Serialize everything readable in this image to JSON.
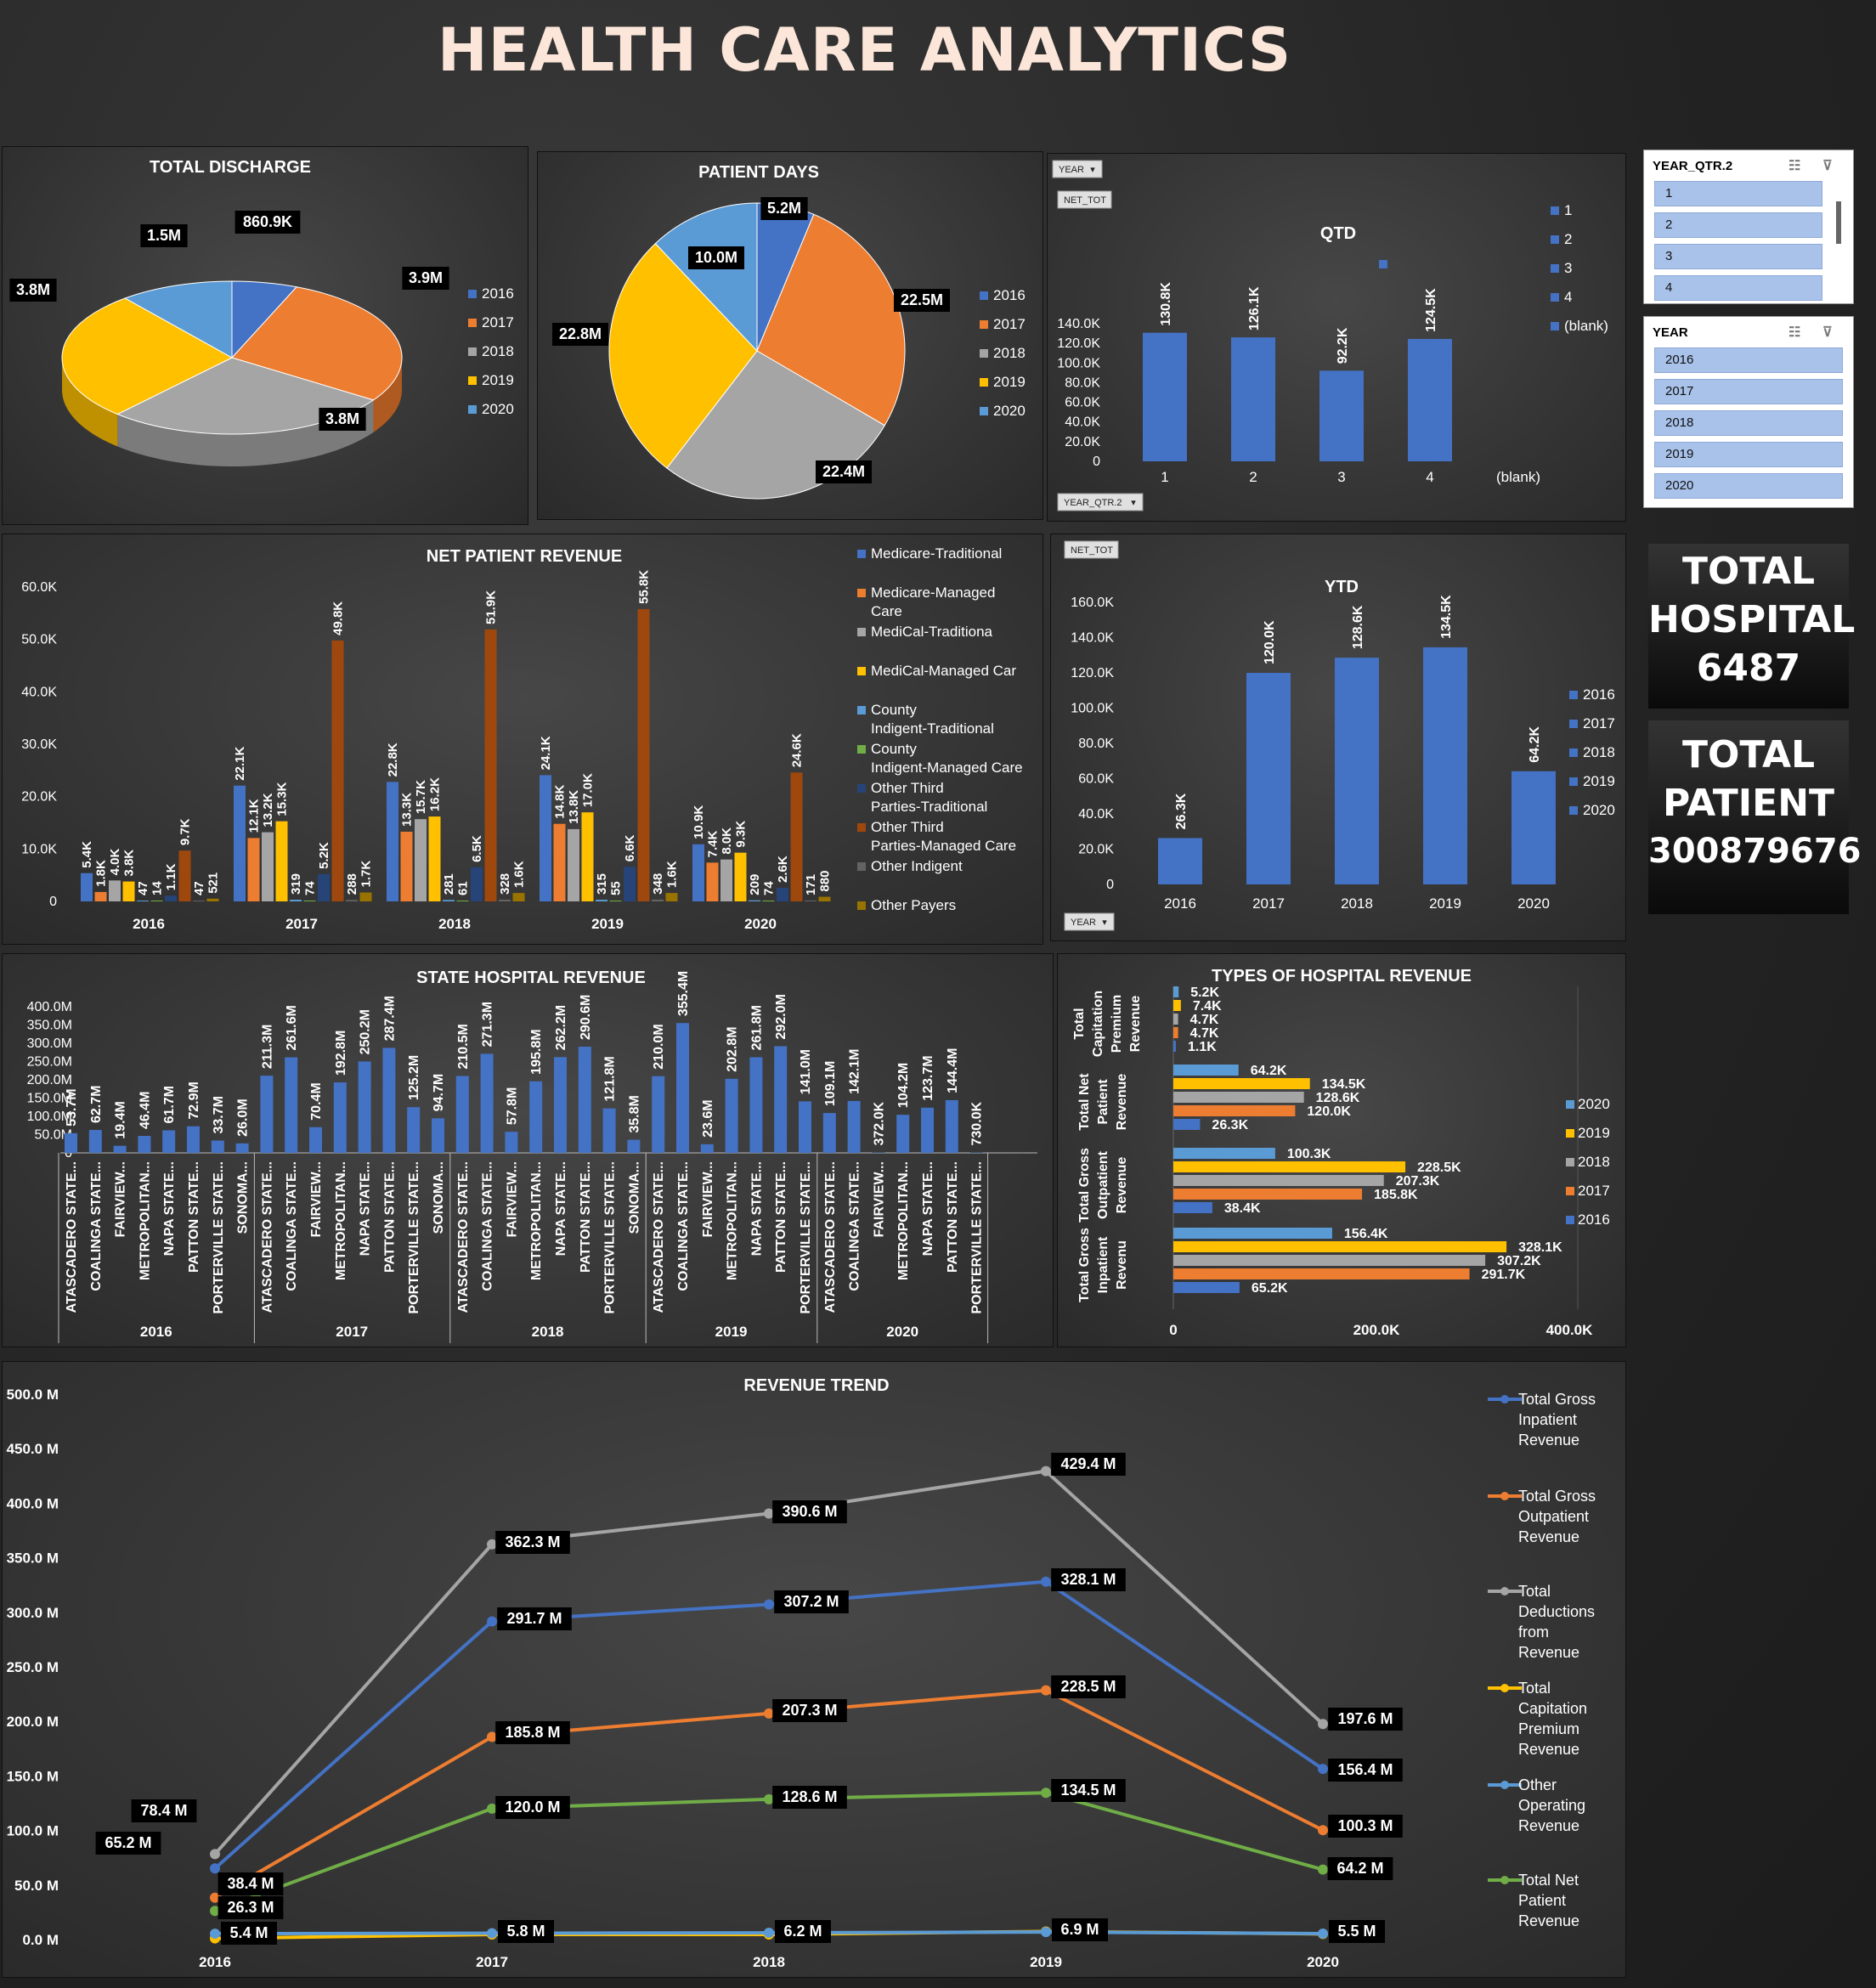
{
  "title": "HEALTH CARE ANALYTICS",
  "years": [
    "2016",
    "2017",
    "2018",
    "2019",
    "2020"
  ],
  "colors": {
    "y2016": "#4472c4",
    "y2017": "#ed7d31",
    "y2018": "#a5a5a5",
    "y2019": "#ffc000",
    "y2020": "#5b9bd5"
  },
  "slicers": {
    "qtr": {
      "title": "YEAR_QTR.2",
      "items": [
        "1",
        "2",
        "3",
        "4"
      ]
    },
    "year": {
      "title": "YEAR",
      "items": [
        "2016",
        "2017",
        "2018",
        "2019",
        "2020"
      ]
    }
  },
  "kpis": {
    "hospital": {
      "l1": "TOTAL",
      "l2": "HOSPITAL",
      "value": "6487"
    },
    "patient": {
      "l1": "TOTAL",
      "l2": "PATIENT",
      "value": "300879676"
    }
  },
  "chart_data": [
    {
      "id": "discharge",
      "type": "pie",
      "title": "TOTAL DISCHARGE",
      "categories": [
        "2016",
        "2017",
        "2018",
        "2019",
        "2020"
      ],
      "values": [
        860.9,
        3900,
        3800,
        3800,
        1500
      ],
      "labels": [
        "860.9K",
        "3.9M",
        "3.8M",
        "3.8M",
        "1.5M"
      ],
      "legend": "right"
    },
    {
      "id": "patient_days",
      "type": "pie",
      "title": "PATIENT DAYS",
      "categories": [
        "2016",
        "2017",
        "2018",
        "2019",
        "2020"
      ],
      "values": [
        5.2,
        22.5,
        22.4,
        22.8,
        10.0
      ],
      "labels": [
        "5.2M",
        "22.5M",
        "22.4M",
        "22.8M",
        "10.0M"
      ],
      "legend": "right"
    },
    {
      "id": "qtd",
      "type": "bar",
      "title": "QTD",
      "field_buttons": [
        "YEAR",
        "NET_TOT",
        "YEAR_QTR.2"
      ],
      "categories": [
        "1",
        "2",
        "3",
        "4",
        "(blank)"
      ],
      "values": [
        130.8,
        126.1,
        92.2,
        124.5,
        null
      ],
      "labels": [
        "130.8K",
        "126.1K",
        "92.2K",
        "124.5K",
        ""
      ],
      "ylim": [
        0,
        140
      ],
      "yticks": [
        "0",
        "20.0K",
        "40.0K",
        "60.0K",
        "80.0K",
        "100.0K",
        "120.0K",
        "140.0K"
      ],
      "legend": [
        "1",
        "2",
        "3",
        "4",
        "(blank)"
      ]
    },
    {
      "id": "net_patient_revenue",
      "type": "bar",
      "title": "NET PATIENT REVENUE",
      "categories": [
        "2016",
        "2017",
        "2018",
        "2019",
        "2020"
      ],
      "series": [
        {
          "name": "Medicare-Traditional",
          "color": "#4472c4",
          "values": [
            5.4,
            22.1,
            22.8,
            24.1,
            10.9
          ],
          "labels": [
            "5.4K",
            "22.1K",
            "22.8K",
            "24.1K",
            "10.9K"
          ]
        },
        {
          "name": "Medicare-Managed Care",
          "color": "#ed7d31",
          "values": [
            1.8,
            12.1,
            13.3,
            14.8,
            7.4
          ],
          "labels": [
            "1.8K",
            "12.1K",
            "13.3K",
            "14.8K",
            "7.4K"
          ]
        },
        {
          "name": "MediCal-Traditiona",
          "color": "#a5a5a5",
          "values": [
            4.0,
            13.2,
            15.7,
            13.8,
            8.0
          ],
          "labels": [
            "4.0K",
            "13.2K",
            "15.7K",
            "13.8K",
            "8.0K"
          ]
        },
        {
          "name": "MediCal-Managed Car",
          "color": "#ffc000",
          "values": [
            3.8,
            15.3,
            16.2,
            17.0,
            9.3
          ],
          "labels": [
            "3.8K",
            "15.3K",
            "16.2K",
            "17.0K",
            "9.3K"
          ]
        },
        {
          "name": "County Indigent-Traditional",
          "color": "#5b9bd5",
          "values": [
            0.047,
            0.319,
            0.281,
            0.315,
            0.209
          ],
          "labels": [
            "47",
            "319",
            "281",
            "315",
            "209"
          ]
        },
        {
          "name": "County Indigent-Managed Care",
          "color": "#70ad47",
          "values": [
            0.014,
            0.074,
            0.061,
            0.055,
            0.074
          ],
          "labels": [
            "14",
            "74",
            "61",
            "55",
            "74"
          ]
        },
        {
          "name": "Other Third Parties-Traditional",
          "color": "#264478",
          "values": [
            1.1,
            5.2,
            6.5,
            6.6,
            2.6
          ],
          "labels": [
            "1.1K",
            "5.2K",
            "6.5K",
            "6.6K",
            "2.6K"
          ]
        },
        {
          "name": "Other Third Parties-Managed Care",
          "color": "#9e480e",
          "values": [
            9.7,
            49.8,
            51.9,
            55.8,
            24.6
          ],
          "labels": [
            "9.7K",
            "49.8K",
            "51.9K",
            "55.8K",
            "24.6K"
          ]
        },
        {
          "name": "Other Indigent",
          "color": "#636363",
          "values": [
            0.047,
            0.288,
            0.328,
            0.348,
            0.171
          ],
          "labels": [
            "47",
            "288",
            "328",
            "348",
            "171"
          ]
        },
        {
          "name": "Other Payers",
          "color": "#997300",
          "values": [
            0.521,
            1.7,
            1.6,
            1.6,
            0.88
          ],
          "labels": [
            "521",
            "1.7K",
            "1.6K",
            "1.6K",
            "880"
          ]
        }
      ],
      "ylim": [
        0,
        60
      ],
      "yticks": [
        "0",
        "10.0K",
        "20.0K",
        "30.0K",
        "40.0K",
        "50.0K",
        "60.0K"
      ]
    },
    {
      "id": "ytd",
      "type": "bar",
      "title": "YTD",
      "field_buttons": [
        "NET_TOT",
        "YEAR"
      ],
      "categories": [
        "2016",
        "2017",
        "2018",
        "2019",
        "2020"
      ],
      "values": [
        26.3,
        120.0,
        128.6,
        134.5,
        64.2
      ],
      "labels": [
        "26.3K",
        "120.0K",
        "128.6K",
        "134.5K",
        "64.2K"
      ],
      "ylim": [
        0,
        160
      ],
      "yticks": [
        "0",
        "20.0K",
        "40.0K",
        "60.0K",
        "80.0K",
        "100.0K",
        "120.0K",
        "140.0K",
        "160.0K"
      ],
      "legend": [
        "2016",
        "2017",
        "2018",
        "2019",
        "2020"
      ]
    },
    {
      "id": "state_hospital_revenue",
      "type": "bar",
      "title": "STATE HOSPITAL REVENUE",
      "groups": [
        {
          "year": "2016",
          "bars": [
            [
              "ATASCADERO STATE...",
              53.7,
              "53.7M"
            ],
            [
              "COALINGA STATE...",
              62.7,
              "62.7M"
            ],
            [
              "FAIRVIEW...",
              19.4,
              "19.4M"
            ],
            [
              "METROPOLITAN...",
              46.4,
              "46.4M"
            ],
            [
              "NAPA STATE...",
              61.7,
              "61.7M"
            ],
            [
              "PATTON STATE...",
              72.9,
              "72.9M"
            ],
            [
              "PORTERVILLE STATE...",
              33.7,
              "33.7M"
            ],
            [
              "SONOMA...",
              26.0,
              "26.0M"
            ]
          ]
        },
        {
          "year": "2017",
          "bars": [
            [
              "ATASCADERO STATE...",
              211.3,
              "211.3M"
            ],
            [
              "COALINGA STATE...",
              261.6,
              "261.6M"
            ],
            [
              "FAIRVIEW...",
              70.4,
              "70.4M"
            ],
            [
              "METROPOLITAN...",
              192.8,
              "192.8M"
            ],
            [
              "NAPA STATE...",
              250.2,
              "250.2M"
            ],
            [
              "PATTON STATE...",
              287.4,
              "287.4M"
            ],
            [
              "PORTERVILLE STATE...",
              125.2,
              "125.2M"
            ],
            [
              "SONOMA...",
              94.7,
              "94.7M"
            ]
          ]
        },
        {
          "year": "2018",
          "bars": [
            [
              "ATASCADERO STATE...",
              210.5,
              "210.5M"
            ],
            [
              "COALINGA STATE...",
              271.3,
              "271.3M"
            ],
            [
              "FAIRVIEW...",
              57.8,
              "57.8M"
            ],
            [
              "METROPOLITAN...",
              195.8,
              "195.8M"
            ],
            [
              "NAPA STATE...",
              262.2,
              "262.2M"
            ],
            [
              "PATTON STATE...",
              290.6,
              "290.6M"
            ],
            [
              "PORTERVILLE STATE...",
              121.8,
              "121.8M"
            ],
            [
              "SONOMA...",
              35.8,
              "35.8M"
            ]
          ]
        },
        {
          "year": "2019",
          "bars": [
            [
              "ATASCADERO STATE...",
              210.0,
              "210.0M"
            ],
            [
              "COALINGA STATE...",
              355.4,
              "355.4M"
            ],
            [
              "FAIRVIEW...",
              23.6,
              "23.6M"
            ],
            [
              "METROPOLITAN...",
              202.8,
              "202.8M"
            ],
            [
              "NAPA STATE...",
              261.8,
              "261.8M"
            ],
            [
              "PATTON STATE...",
              292.0,
              "292.0M"
            ],
            [
              "PORTERVILLE STATE...",
              141.0,
              "141.0M"
            ]
          ]
        },
        {
          "year": "2020",
          "bars": [
            [
              "ATASCADERO STATE...",
              109.1,
              "109.1M"
            ],
            [
              "COALINGA STATE...",
              142.1,
              "142.1M"
            ],
            [
              "FAIRVIEW...",
              0.372,
              "372.0K"
            ],
            [
              "METROPOLITAN...",
              104.2,
              "104.2M"
            ],
            [
              "NAPA STATE...",
              123.7,
              "123.7M"
            ],
            [
              "PATTON STATE...",
              144.4,
              "144.4M"
            ],
            [
              "PORTERVILLE STATE...",
              0.73,
              "730.0K"
            ]
          ]
        }
      ],
      "ylim": [
        0,
        400
      ],
      "yticks": [
        "0",
        "50.0M",
        "100.0M",
        "150.0M",
        "200.0M",
        "250.0M",
        "300.0M",
        "350.0M",
        "400.0M"
      ]
    },
    {
      "id": "types_of_hospital_revenue",
      "type": "bar",
      "orientation": "horizontal",
      "title": "TYPES OF HOSPITAL REVENUE",
      "categories": [
        "Total Capitation Premium Revenue",
        "Total Net Patient Revenue",
        "Total Gross Outpatient Revenue",
        "Total Gross Inpatient Revenu"
      ],
      "series": [
        {
          "name": "2020",
          "values": [
            5.2,
            64.2,
            100.3,
            156.4
          ],
          "labels": [
            "5.2K",
            "64.2K",
            "100.3K",
            "156.4K"
          ]
        },
        {
          "name": "2019",
          "values": [
            7.4,
            134.5,
            228.5,
            328.1
          ],
          "labels": [
            "7.4K",
            "134.5K",
            "228.5K",
            "328.1K"
          ]
        },
        {
          "name": "2018",
          "values": [
            4.7,
            128.6,
            207.3,
            307.2
          ],
          "labels": [
            "4.7K",
            "128.6K",
            "207.3K",
            "307.2K"
          ]
        },
        {
          "name": "2017",
          "values": [
            4.7,
            120.0,
            185.8,
            291.7
          ],
          "labels": [
            "4.7K",
            "120.0K",
            "185.8K",
            "291.7K"
          ]
        },
        {
          "name": "2016",
          "values": [
            1.1,
            26.3,
            38.4,
            65.2
          ],
          "labels": [
            "1.1K",
            "26.3K",
            "38.4K",
            "65.2K"
          ]
        }
      ],
      "xlim": [
        0,
        400
      ],
      "xticks": [
        "0",
        "200.0K",
        "400.0K"
      ],
      "legend": "right"
    },
    {
      "id": "revenue_trend",
      "type": "line",
      "title": "REVENUE TREND",
      "x": [
        "2016",
        "2017",
        "2018",
        "2019",
        "2020"
      ],
      "series": [
        {
          "name": "Total Gross Inpatient Revenue",
          "color": "#4472c4",
          "values": [
            65.2,
            291.7,
            307.2,
            328.1,
            156.4
          ],
          "labels": [
            "65.2 M",
            "291.7 M",
            "307.2 M",
            "328.1 M",
            "156.4 M"
          ]
        },
        {
          "name": "Total Gross Outpatient Revenue",
          "color": "#ed7d31",
          "values": [
            38.4,
            185.8,
            207.3,
            228.5,
            100.3
          ],
          "labels": [
            "38.4 M",
            "185.8 M",
            "207.3 M",
            "228.5 M",
            "100.3 M"
          ]
        },
        {
          "name": "Total Deductions from Revenue",
          "color": "#a5a5a5",
          "values": [
            78.4,
            362.3,
            390.6,
            429.4,
            197.6
          ],
          "labels": [
            "78.4 M",
            "362.3 M",
            "390.6 M",
            "429.4 M",
            "197.6 M"
          ]
        },
        {
          "name": "Total Capitation Premium Revenue",
          "color": "#ffc000",
          "values": [
            1.1,
            4.7,
            4.7,
            7.4,
            5.2
          ],
          "labels": [
            "",
            "",
            "",
            "",
            ""
          ]
        },
        {
          "name": "Other Operating Revenue",
          "color": "#5b9bd5",
          "values": [
            5.4,
            5.8,
            6.2,
            6.9,
            5.5
          ],
          "labels": [
            "5.4 M",
            "5.8 M",
            "6.2 M",
            "6.9 M",
            "5.5 M"
          ]
        },
        {
          "name": "Total Net Patient Revenue",
          "color": "#70ad47",
          "values": [
            26.3,
            120.0,
            128.6,
            134.5,
            64.2
          ],
          "labels": [
            "26.3 M",
            "120.0 M",
            "128.6 M",
            "134.5 M",
            "64.2 M"
          ]
        }
      ],
      "ylim": [
        0,
        500
      ],
      "yticks": [
        "0.0 M",
        "50.0 M",
        "100.0 M",
        "150.0 M",
        "200.0 M",
        "250.0 M",
        "300.0 M",
        "350.0 M",
        "400.0 M",
        "450.0 M",
        "500.0 M"
      ],
      "legend": "right"
    }
  ]
}
